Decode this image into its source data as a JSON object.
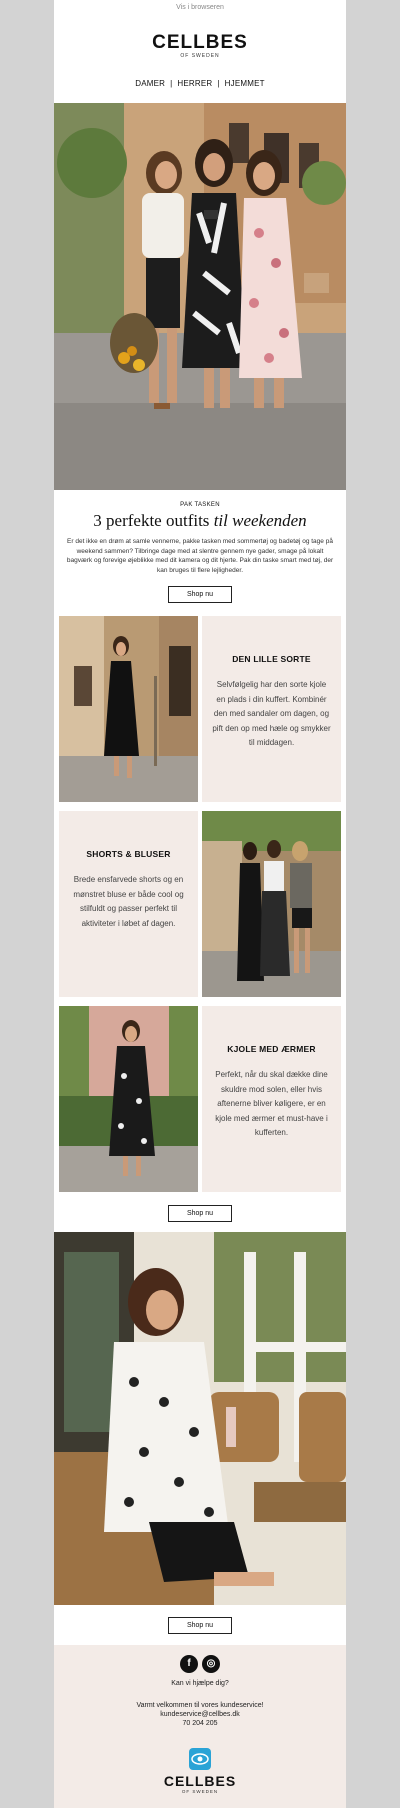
{
  "header": {
    "browser_link": "Vis i browseren",
    "logo_name": "CELLBES",
    "logo_sub": "OF SWEDEN",
    "nav": [
      "DAMER",
      "HERRER",
      "HJEMMET"
    ],
    "nav_separator": "|"
  },
  "intro": {
    "eyebrow": "PAK TASKEN",
    "headline_plain": "3 perfekte outfits",
    "headline_italic": "til weekenden",
    "body": "Er det ikke en drøm at samle vennerne, pakke tasken med sommertøj og badetøj og tage på weekend sammen? Tilbringe dage med at slentre gennem nye gader, smage på lokalt bagværk og forevige øjeblikke med dit kamera og dit hjerte. Pak din taske smart med tøj, der kan bruges til flere lejligheder.",
    "button": "Shop nu"
  },
  "outfits": [
    {
      "title": "DEN LILLE SORTE",
      "body": "Selvfølgelig har den sorte kjole en plads i din kuffert. Kombinér den med sandaler om dagen, og pift den op med hæle og smykker til middagen."
    },
    {
      "title": "SHORTS & BLUSER",
      "body": "Brede ensfarvede shorts og en mønstret bluse er både cool og stilfuldt og passer perfekt til aktiviteter i løbet af dagen."
    },
    {
      "title": "KJOLE MED ÆRMER",
      "body": "Perfekt, når du skal dække dine skuldre mod solen, eller hvis aftenerne bliver køligere, er en kjole med ærmer et must-have i kufferten."
    }
  ],
  "buttons": {
    "shop_outfits": "Shop nu",
    "shop_second": "Shop nu"
  },
  "footer": {
    "social_facebook": "f",
    "social_instagram": "◎",
    "help": "Kan vi hjælpe dig?",
    "welcome": "Varmt velkommen til vores kundeservice!",
    "email": "kundeservice@cellbes.dk",
    "phone": "70 204 205",
    "logo_name": "CELLBES",
    "logo_sub": "OF SWEDEN"
  },
  "colors": {
    "page_bg": "#d3d3d3",
    "panel_bg": "#f3ebe7",
    "accent_icon": "#2aa3d6"
  },
  "icons": [
    "facebook-icon",
    "instagram-icon",
    "eye-logo-icon"
  ]
}
